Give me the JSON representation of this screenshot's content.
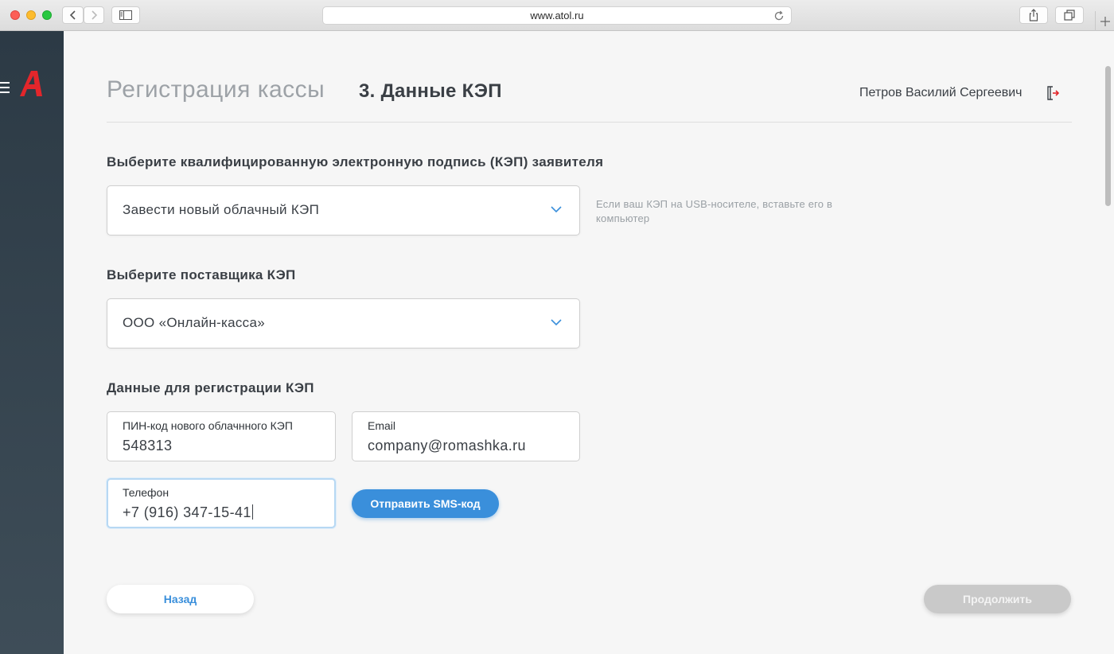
{
  "browser": {
    "url": "www.atol.ru"
  },
  "header": {
    "page_title": "Регистрация кассы",
    "step_title": "3. Данные КЭП",
    "user_name": "Петров Василий Сергеевич"
  },
  "kep_select": {
    "label": "Выберите квалифицированную электронную подпись (КЭП) заявителя",
    "value": "Завести новый облачный КЭП",
    "hint": "Если ваш КЭП на USB-носителе, вставьте его в компьютер"
  },
  "provider_select": {
    "label": "Выберите поставщика КЭП",
    "value": "ООО «Онлайн-касса»"
  },
  "registration": {
    "label": "Данные для регистрации КЭП",
    "pin": {
      "label": "ПИН-код нового облачнного КЭП",
      "value": "548313"
    },
    "email": {
      "label": "Email",
      "value": "company@romashka.ru"
    },
    "phone": {
      "label": "Телефон",
      "value": "+7 (916) 347-15-41"
    },
    "send_sms_label": "Отправить SMS-код"
  },
  "footer": {
    "back_label": "Назад",
    "next_label": "Продолжить"
  },
  "colors": {
    "accent": "#3a8fdb",
    "sidebar": "#2c3a45",
    "logo": "#e3262b"
  }
}
